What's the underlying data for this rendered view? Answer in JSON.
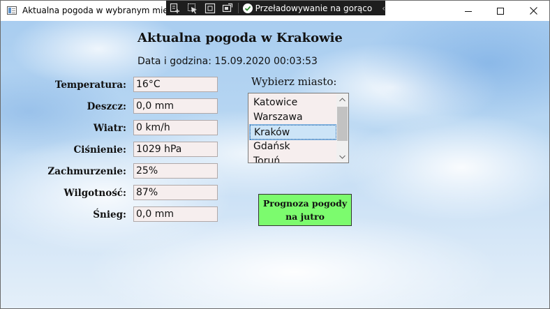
{
  "window": {
    "title": "Aktualna pogoda w wybranym mieście"
  },
  "debug_toolbar": {
    "icons": [
      "live-visual-tree-icon",
      "select-element-icon",
      "display-layout-adorners-icon",
      "track-focus-icon"
    ],
    "status_text": "Przeładowywanie na gorąco"
  },
  "main": {
    "heading": "Aktualna pogoda w Krakowie",
    "datetime": "Data i godzina: 15.09.2020 00:03:53"
  },
  "fields": [
    {
      "label": "Temperatura:",
      "value": "16°C"
    },
    {
      "label": "Deszcz:",
      "value": "0,0 mm"
    },
    {
      "label": "Wiatr:",
      "value": "0 km/h"
    },
    {
      "label": "Ciśnienie:",
      "value": "1029 hPa"
    },
    {
      "label": "Zachmurzenie:",
      "value": "25%"
    },
    {
      "label": "Wilgotność:",
      "value": "87%"
    },
    {
      "label": "Śnieg:",
      "value": "0,0 mm"
    }
  ],
  "city_picker": {
    "label": "Wybierz miasto:",
    "items": [
      "Katowice",
      "Warszawa",
      "Kraków",
      "Gdańsk",
      "Toruń"
    ],
    "selected": "Kraków"
  },
  "forecast_button": {
    "line1": "Prognoza pogody",
    "line2": "na jutro",
    "color": "#7cfb6e"
  }
}
